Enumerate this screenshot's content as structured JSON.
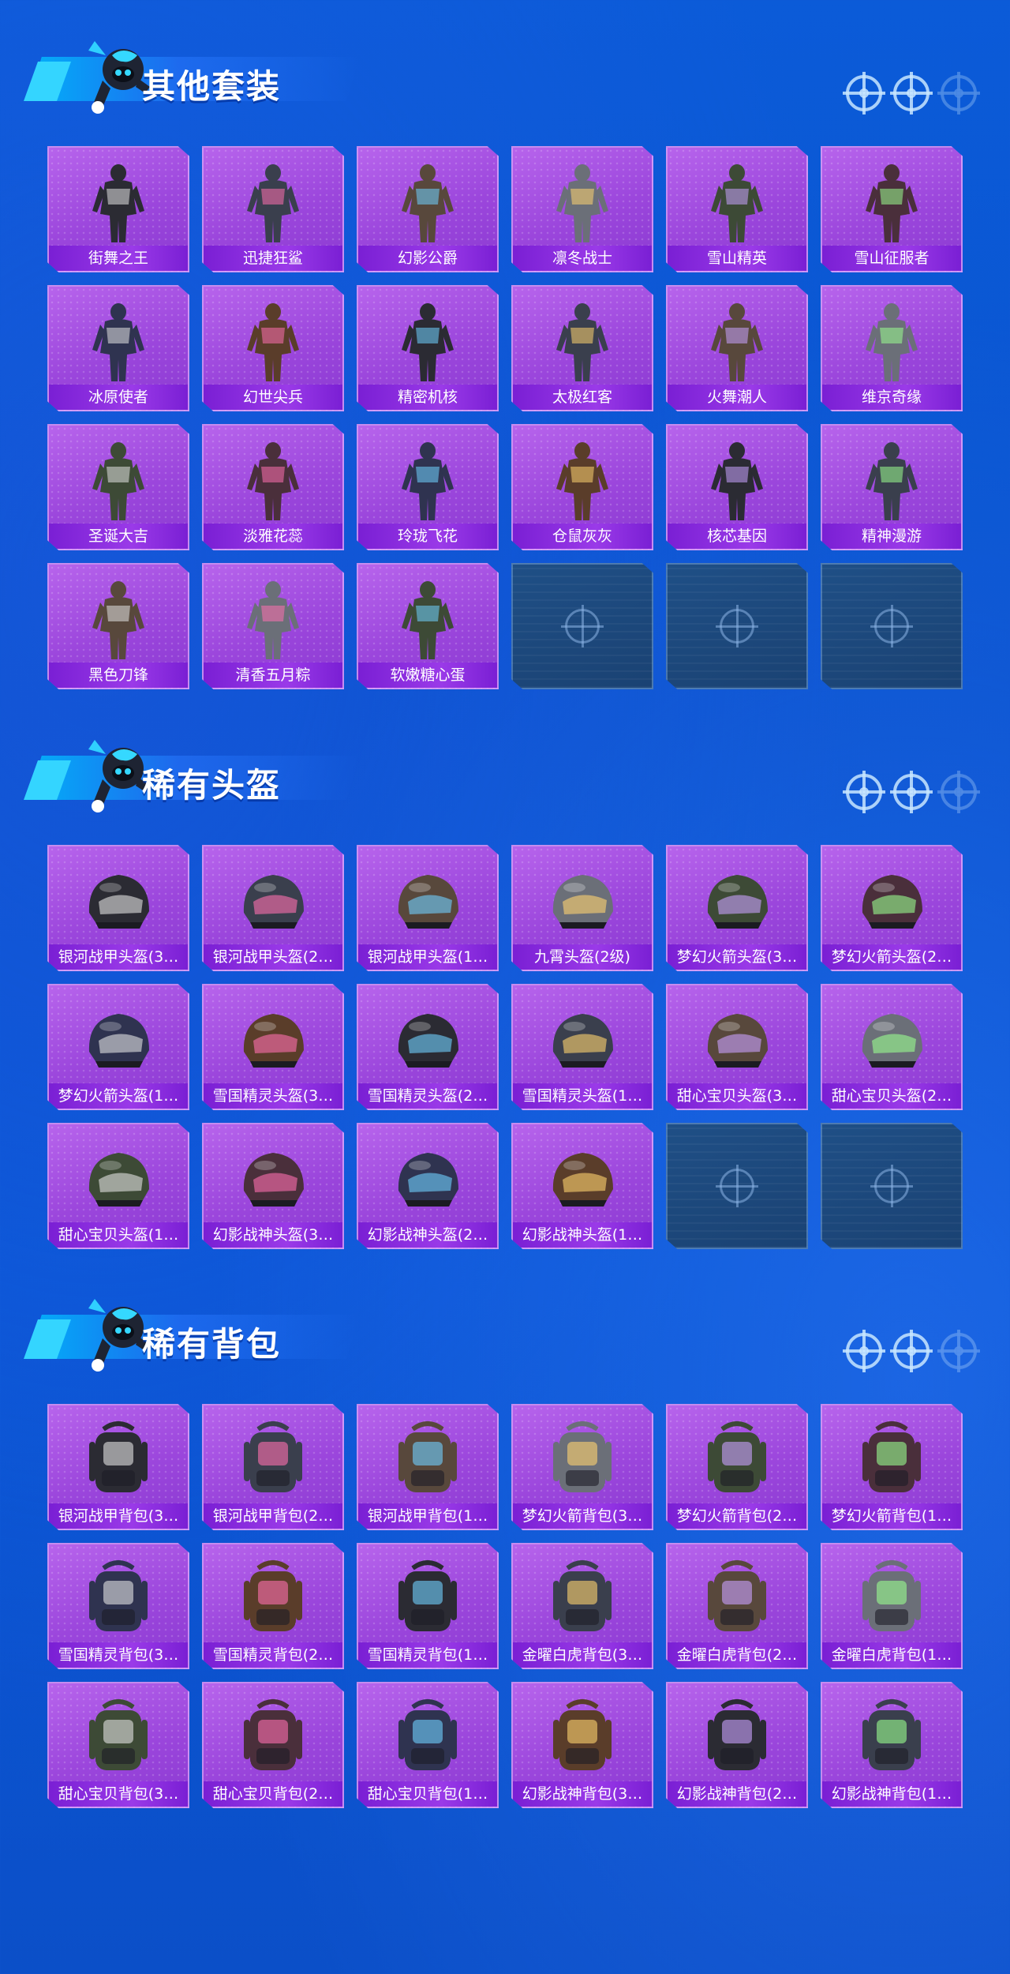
{
  "sections": [
    {
      "title": "其他套装",
      "kind": "outfit",
      "items": [
        "街舞之王",
        "迅捷狂鲨",
        "幻影公爵",
        "凛冬战士",
        "雪山精英",
        "雪山征服者",
        "冰原使者",
        "幻世尖兵",
        "精密机核",
        "太极红客",
        "火舞潮人",
        "维京奇缘",
        "圣诞大吉",
        "淡雅花蕊",
        "玲珑飞花",
        "仓鼠灰灰",
        "核芯基因",
        "精神漫游",
        "黑色刀锋",
        "清香五月粽",
        "软嫩糖心蛋",
        "",
        "",
        ""
      ]
    },
    {
      "title": "稀有头盔",
      "kind": "helmet",
      "items": [
        "银河战甲头盔(3…",
        "银河战甲头盔(2…",
        "银河战甲头盔(1…",
        "九霄头盔(2级)",
        "梦幻火箭头盔(3…",
        "梦幻火箭头盔(2…",
        "梦幻火箭头盔(1…",
        "雪国精灵头盔(3…",
        "雪国精灵头盔(2…",
        "雪国精灵头盔(1…",
        "甜心宝贝头盔(3…",
        "甜心宝贝头盔(2…",
        "甜心宝贝头盔(1…",
        "幻影战神头盔(3…",
        "幻影战神头盔(2…",
        "幻影战神头盔(1…",
        "",
        ""
      ]
    },
    {
      "title": "稀有背包",
      "kind": "backpack",
      "items": [
        "银河战甲背包(3…",
        "银河战甲背包(2…",
        "银河战甲背包(1…",
        "梦幻火箭背包(3…",
        "梦幻火箭背包(2…",
        "梦幻火箭背包(1…",
        "雪国精灵背包(3…",
        "雪国精灵背包(2…",
        "雪国精灵背包(1…",
        "金曜白虎背包(3…",
        "金曜白虎背包(2…",
        "金曜白虎背包(1…",
        "甜心宝贝背包(3…",
        "甜心宝贝背包(2…",
        "甜心宝贝背包(1…",
        "幻影战神背包(3…",
        "幻影战神背包(2…",
        "幻影战神背包(1…"
      ]
    }
  ],
  "colors": {
    "card_purple": "#a855e6",
    "label_purple": "#8a2be2",
    "background_blue": "#0b55d4",
    "empty_slot": "#1f4a80"
  },
  "icons": {
    "header_decoration": "crosshair-icon",
    "empty_slot": "crosshair-icon",
    "mascot": "mascot-icon"
  }
}
